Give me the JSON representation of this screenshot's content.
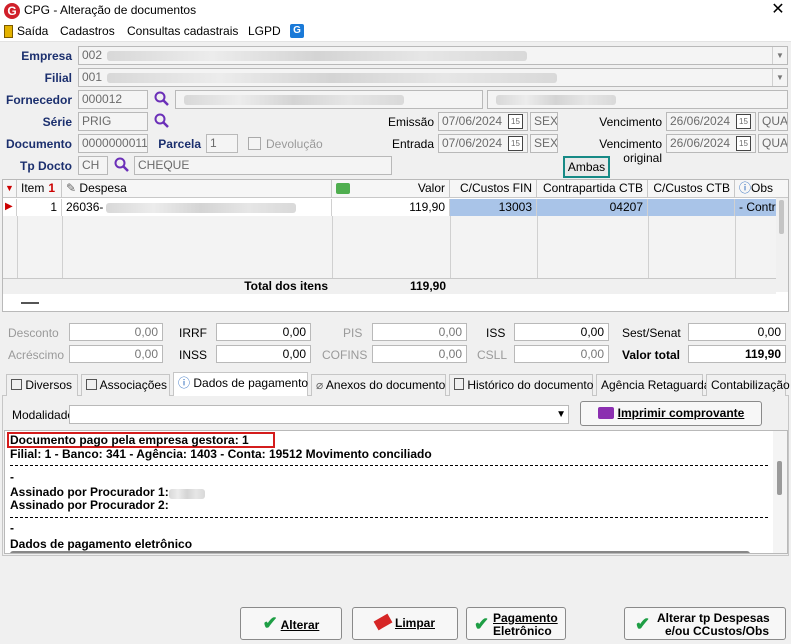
{
  "window": {
    "title": "CPG - Alteração de documentos",
    "logo": "G"
  },
  "menu": [
    "Saída",
    "Cadastros",
    "Consultas cadastrais",
    "LGPD"
  ],
  "form": {
    "empresa_label": "Empresa",
    "empresa_value": "002",
    "filial_label": "Filial",
    "filial_value": "001",
    "fornecedor_label": "Fornecedor",
    "fornecedor_value": "000012",
    "serie_label": "Série",
    "serie_value": "PRIG",
    "documento_label": "Documento",
    "documento_value": "0000000011",
    "parcela_label": "Parcela",
    "parcela_value": "1",
    "devolucao_label": "Devolução",
    "tpdocto_label": "Tp Docto",
    "tpdocto_code": "CH",
    "tpdocto_desc": "CHEQUE",
    "emissao_label": "Emissão",
    "emissao_value": "07/06/2024",
    "emissao_dow": "SEX",
    "entrada_label": "Entrada",
    "entrada_value": "07/06/2024",
    "entrada_dow": "SEX",
    "vencimento_label": "Vencimento",
    "vencimento_value": "26/06/2024",
    "vencimento_dow": "QUA",
    "venc_orig_label": "Vencimento original",
    "venc_orig_value": "26/06/2024",
    "venc_orig_dow": "QUA",
    "ambas_label": "Ambas"
  },
  "grid": {
    "headers": {
      "item": "Item",
      "despesa": "Despesa",
      "valor": "Valor",
      "ccfin": "C/Custos FIN",
      "contrapartida": "Contrapartida CTB",
      "ccctb": "C/Custos CTB",
      "obs": "Obs"
    },
    "row": {
      "item": "1",
      "despesa": "26036-",
      "valor": "119,90",
      "ccfin": "13003",
      "contrapartida": "04207",
      "obs": "- Contra"
    },
    "total_label": "Total dos itens",
    "total_value": "119,90"
  },
  "totals": {
    "desconto_label": "Desconto",
    "desconto_value": "0,00",
    "acrescimo_label": "Acréscimo",
    "acrescimo_value": "0,00",
    "irrf_label": "IRRF",
    "irrf_value": "0,00",
    "inss_label": "INSS",
    "inss_value": "0,00",
    "pis_label": "PIS",
    "pis_value": "0,00",
    "cofins_label": "COFINS",
    "cofins_value": "0,00",
    "iss_label": "ISS",
    "iss_value": "0,00",
    "csll_label": "CSLL",
    "csll_value": "0,00",
    "sestsenat_label": "Sest/Senat",
    "sestsenat_value": "0,00",
    "valortotal_label": "Valor total",
    "valortotal_value": "119,90"
  },
  "tabs": [
    "Diversos",
    "Associações",
    "Dados de pagamento",
    "Anexos do documento",
    "Histórico do documento",
    "Agência Retaguarda",
    "Contabilização"
  ],
  "payment": {
    "modalidade_label": "Modalidade",
    "print_button": "Imprimir comprovante",
    "lines": {
      "l1": "Documento pago pela empresa gestora: 1",
      "l2": "Filial: 1 - Banco: 341 - Agência: 1403 - Conta: 19512 Movimento conciliado",
      "l3": "-",
      "l4": "Assinado por Procurador 1:",
      "l5": "Assinado por Procurador 2:",
      "l6": "-",
      "l7": "Dados de pagamento eletrônico"
    }
  },
  "buttons": {
    "alterar": "Alterar",
    "limpar": "Limpar",
    "pagamento_line1": "Pagamento",
    "pagamento_line2": "Eletrônico",
    "alterar_tp_line1": "Alterar tp Despesas",
    "alterar_tp_line2": "e/ou CCustos/Obs"
  },
  "colors": {
    "accent_blue": "#1b2f6e",
    "selection": "#a9c4e8",
    "highlight_red": "#d41c1c",
    "teal_box": "#178a86"
  }
}
